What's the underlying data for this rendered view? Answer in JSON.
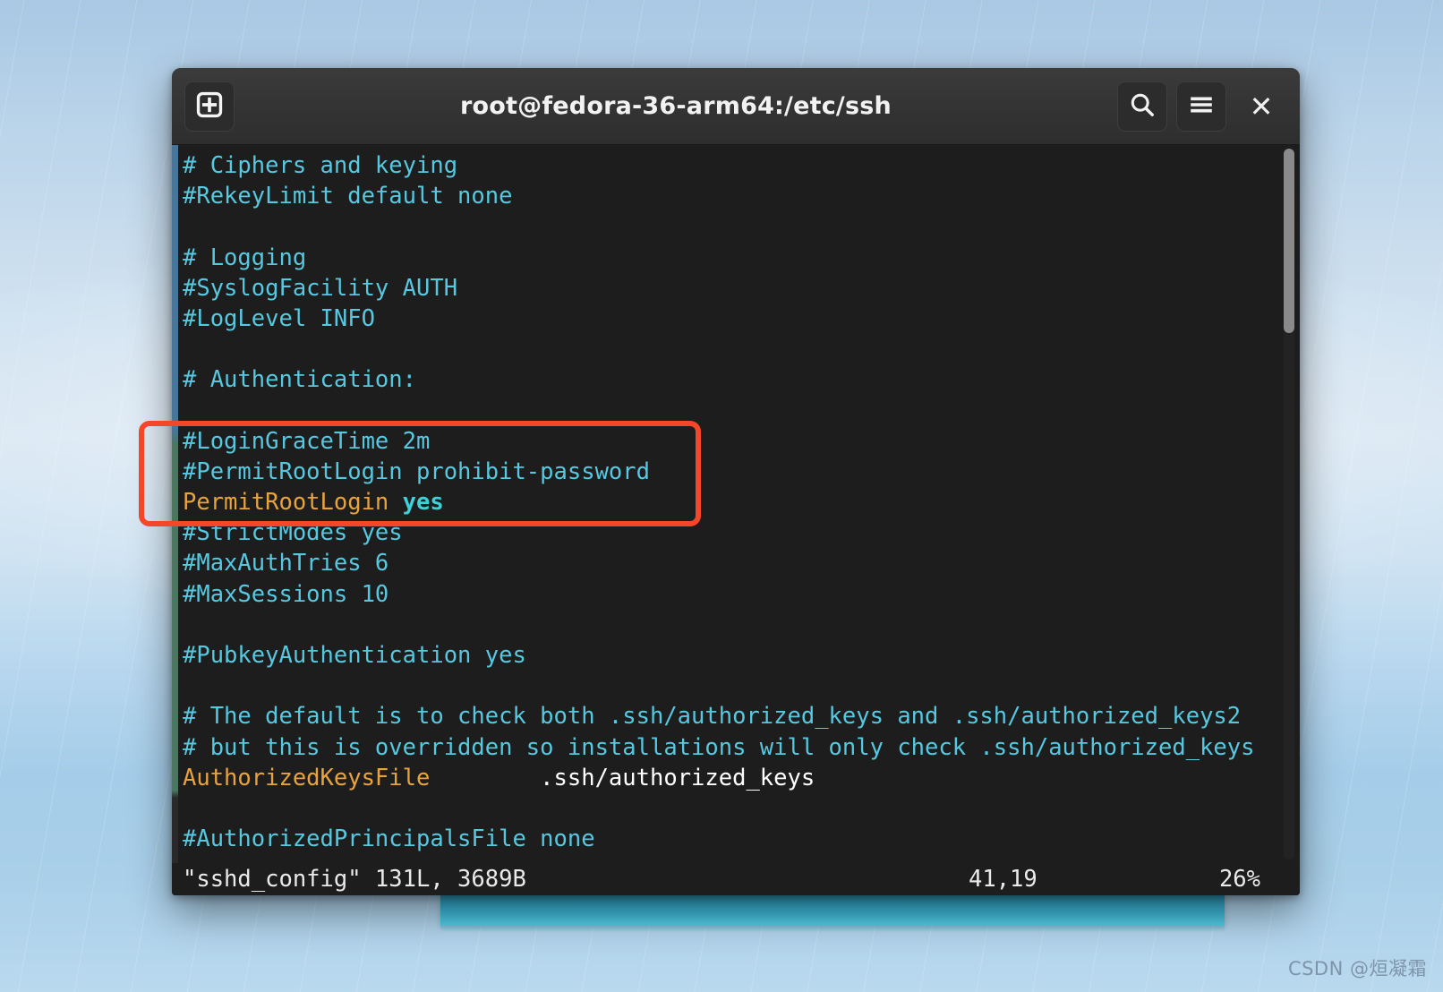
{
  "window": {
    "title": "root@fedora-36-arm64:/etc/ssh",
    "new_tab_icon": "new-tab-plus-icon",
    "search_icon": "search-icon",
    "menu_icon": "hamburger-menu-icon",
    "close_label": "✕"
  },
  "terminal": {
    "lines": [
      {
        "text": "# Ciphers and keying",
        "type": "comment"
      },
      {
        "text": "#RekeyLimit default none",
        "type": "comment"
      },
      {
        "text": "",
        "type": "blank"
      },
      {
        "text": "# Logging",
        "type": "comment"
      },
      {
        "text": "#SyslogFacility AUTH",
        "type": "comment"
      },
      {
        "text": "#LogLevel INFO",
        "type": "comment"
      },
      {
        "text": "",
        "type": "blank"
      },
      {
        "text": "# Authentication:",
        "type": "comment"
      },
      {
        "text": "",
        "type": "blank"
      },
      {
        "text": "#LoginGraceTime 2m",
        "type": "comment"
      },
      {
        "text": "#PermitRootLogin prohibit-password",
        "type": "comment"
      },
      {
        "text": "PermitRootLogin yes",
        "type": "directive",
        "key": "PermitRootLogin",
        "value": "yes"
      },
      {
        "text": "#StrictModes yes",
        "type": "comment"
      },
      {
        "text": "#MaxAuthTries 6",
        "type": "comment"
      },
      {
        "text": "#MaxSessions 10",
        "type": "comment"
      },
      {
        "text": "",
        "type": "blank"
      },
      {
        "text": "#PubkeyAuthentication yes",
        "type": "comment"
      },
      {
        "text": "",
        "type": "blank"
      },
      {
        "text": "# The default is to check both .ssh/authorized_keys and .ssh/authorized_keys2",
        "type": "comment"
      },
      {
        "text": "# but this is overridden so installations will only check .ssh/authorized_keys",
        "type": "comment"
      },
      {
        "text": "AuthorizedKeysFile\t.ssh/authorized_keys",
        "type": "directive",
        "key": "AuthorizedKeysFile",
        "value": ".ssh/authorized_keys"
      },
      {
        "text": "",
        "type": "blank"
      },
      {
        "text": "#AuthorizedPrincipalsFile none",
        "type": "comment"
      }
    ],
    "statusline": {
      "file": "\"sshd_config\" 131L, 3689B",
      "position": "41,19",
      "percent": "26%"
    },
    "colors": {
      "background": "#1d1d1d",
      "comment": "#56c8e0",
      "keyword": "#e8a33d",
      "value": "#ffffff",
      "boolean": "#3fd0d8"
    }
  },
  "annotation": {
    "color": "#f4472a",
    "highlighted_lines": [
      "#LoginGraceTime 2m",
      "#PermitRootLogin prohibit-password",
      "PermitRootLogin yes"
    ]
  },
  "watermark": {
    "text": "CSDN @烜凝霜"
  }
}
